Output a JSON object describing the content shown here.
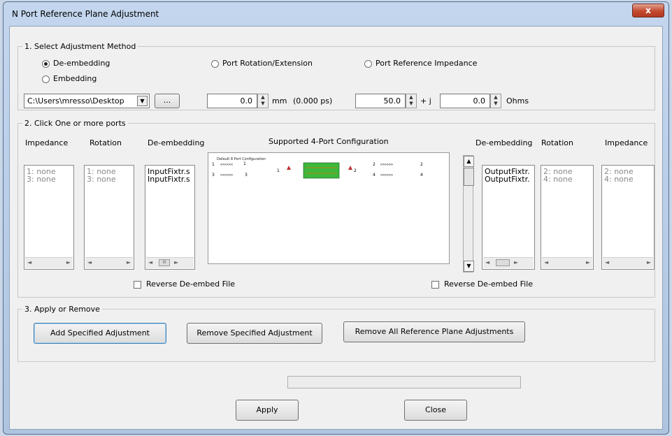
{
  "window": {
    "title": "N Port Reference Plane Adjustment",
    "close_glyph": "x"
  },
  "method": {
    "legend": "1. Select Adjustment Method",
    "options": [
      "De-embedding",
      "Embedding",
      "Port Rotation/Extension",
      "Port Reference Impedance"
    ],
    "selected": "De-embedding",
    "path_value": "C:\\Users\\mresso\\Desktop",
    "browse_label": "...",
    "rotation_value": "0.0",
    "rotation_unit": "mm",
    "rotation_delay": "(0.000 ps)",
    "impedance_real": "50.0",
    "impedance_j": "+ j",
    "impedance_imag": "0.0",
    "impedance_unit": "Ohms"
  },
  "ports": {
    "legend": "2. Click One or more ports",
    "left_headers": [
      "Impedance",
      "Rotation",
      "De-embedding"
    ],
    "right_headers": [
      "De-embedding",
      "Rotation",
      "Impedance"
    ],
    "center_title": "Supported 4-Port Configuration",
    "diagram_title": "Default 8 Port Configuration",
    "diagram_ports": [
      "1",
      "1",
      "3",
      "3",
      "2",
      "2",
      "4",
      "4",
      "1",
      "2"
    ],
    "diagram_dots_left": "<<<<<<",
    "diagram_dots_right": ">>>>>>",
    "left_impedance": [
      "1: none",
      "3: none"
    ],
    "left_rotation": [
      "1: none",
      "3: none"
    ],
    "left_deembed": [
      "InputFixtr.s",
      "InputFixtr.s"
    ],
    "right_deembed": [
      "OutputFixtr.",
      "OutputFixtr."
    ],
    "right_rotation": [
      "2: none",
      "4: none"
    ],
    "right_impedance": [
      "2: none",
      "4: none"
    ],
    "reverse_label": "Reverse De-embed File",
    "reverse_label_right": "Reverse De-embed File",
    "scroll_grip": "III"
  },
  "apply_remove": {
    "legend": "3. Apply or Remove",
    "add": "Add Specified Adjustment",
    "remove": "Remove Specified Adjustment",
    "remove_all": "Remove All Reference Plane Adjustments"
  },
  "footer": {
    "apply": "Apply",
    "close": "Close"
  },
  "colors": {
    "frame": "#b7cbe6",
    "close_button": "#c44a2f",
    "fixture_green": "#3cb83c"
  }
}
